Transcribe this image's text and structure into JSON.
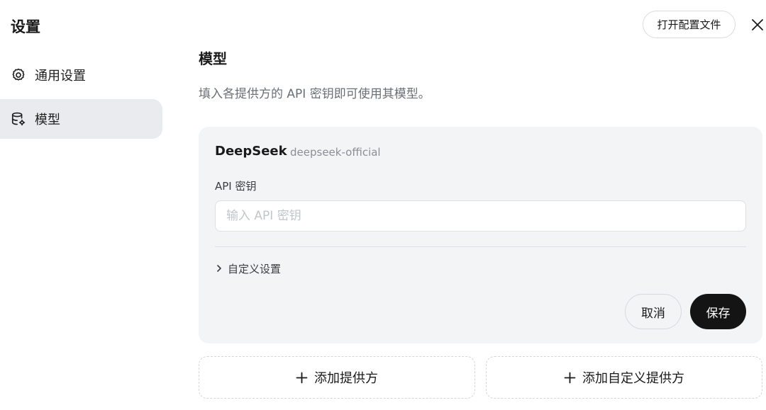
{
  "sidebar": {
    "title": "设置",
    "items": [
      {
        "label": "通用设置",
        "icon": "gear-icon",
        "active": false
      },
      {
        "label": "模型",
        "icon": "database-gear-icon",
        "active": true
      }
    ]
  },
  "header": {
    "open_config_label": "打开配置文件",
    "close_icon": "close-icon"
  },
  "main": {
    "title": "模型",
    "description": "填入各提供方的 API 密钥即可使用其模型。",
    "provider": {
      "name": "DeepSeek",
      "id": "deepseek-official",
      "api_key_label": "API 密钥",
      "api_key_value": "",
      "api_key_placeholder": "输入 API 密钥",
      "custom_settings_label": "自定义设置",
      "cancel_label": "取消",
      "save_label": "保存"
    },
    "add_provider_label": "添加提供方",
    "add_custom_provider_label": "添加自定义提供方"
  },
  "colors": {
    "active_nav_bg": "#e9ebef",
    "card_bg": "#f3f4f6",
    "primary_button": "#141414"
  }
}
